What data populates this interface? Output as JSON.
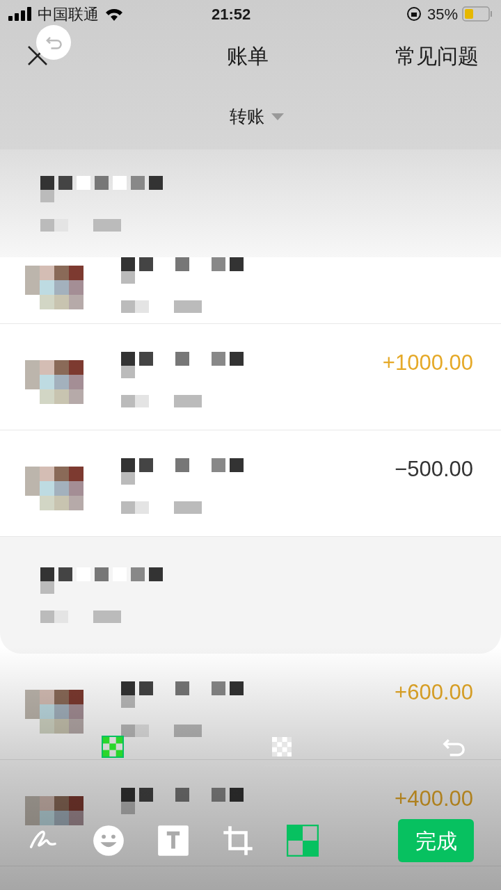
{
  "status_bar": {
    "carrier": "中国联通",
    "time": "21:52",
    "battery": "35%"
  },
  "nav": {
    "title": "账单",
    "action": "常见问题"
  },
  "filter": {
    "label": "转账"
  },
  "transactions": [
    {
      "kind": "income",
      "amount": "+1000.00"
    },
    {
      "kind": "expense",
      "amount": "−500.00"
    },
    {
      "kind": "income",
      "amount": "+600.00"
    },
    {
      "kind": "income",
      "amount": "+400.00"
    }
  ],
  "mosaic_styles": [
    {
      "kind": "grid",
      "selected": true
    },
    {
      "kind": "noise",
      "selected": false
    }
  ],
  "tools": [
    {
      "kind": "pen",
      "selected": false
    },
    {
      "kind": "emoji",
      "selected": false
    },
    {
      "kind": "text",
      "selected": false
    },
    {
      "kind": "crop",
      "selected": false
    },
    {
      "kind": "mosaic",
      "selected": true
    }
  ],
  "done_button": "完成"
}
